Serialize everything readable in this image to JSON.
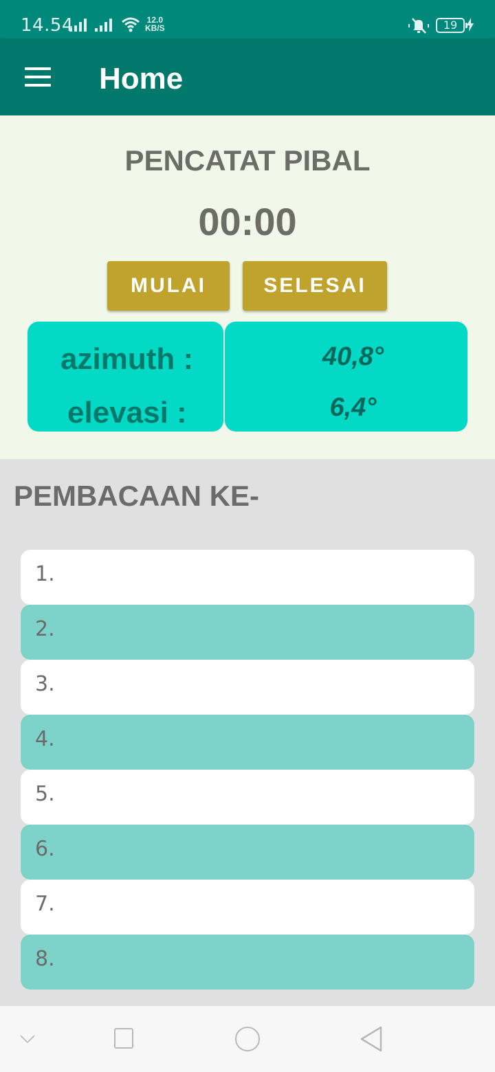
{
  "status_bar": {
    "time": "14.54",
    "net_speed_value": "12.0",
    "net_speed_unit": "KB/S",
    "battery_level": "19",
    "icons": [
      "signal-icon",
      "signal-icon",
      "wifi-icon",
      "mute-icon",
      "battery-icon",
      "charging-icon"
    ]
  },
  "app_bar": {
    "title": "Home",
    "menu_icon": "menu-icon"
  },
  "recorder": {
    "title": "PENCATAT PIBAL",
    "timer": "00:00",
    "start_label": "MULAI",
    "stop_label": "SELESAI",
    "azimuth_label": "azimuth :",
    "azimuth_value": "40,8°",
    "elevation_label": "elevasi :",
    "elevation_value": "6,4°"
  },
  "readings": {
    "heading": "PEMBACAAN KE-",
    "items": [
      "1.",
      "2.",
      "3.",
      "4.",
      "5.",
      "6.",
      "7.",
      "8."
    ]
  },
  "nav_bar": {
    "icons": [
      "chevron-down-icon",
      "recent-apps-icon",
      "home-icon",
      "back-icon"
    ]
  },
  "colors": {
    "status_bar": "#00897b",
    "app_bar": "#00796b",
    "button": "#c0a32c",
    "reading_card": "#03d9c5",
    "list_alt": "#7dd3c9",
    "panel_bg": "#f1f8e9"
  }
}
